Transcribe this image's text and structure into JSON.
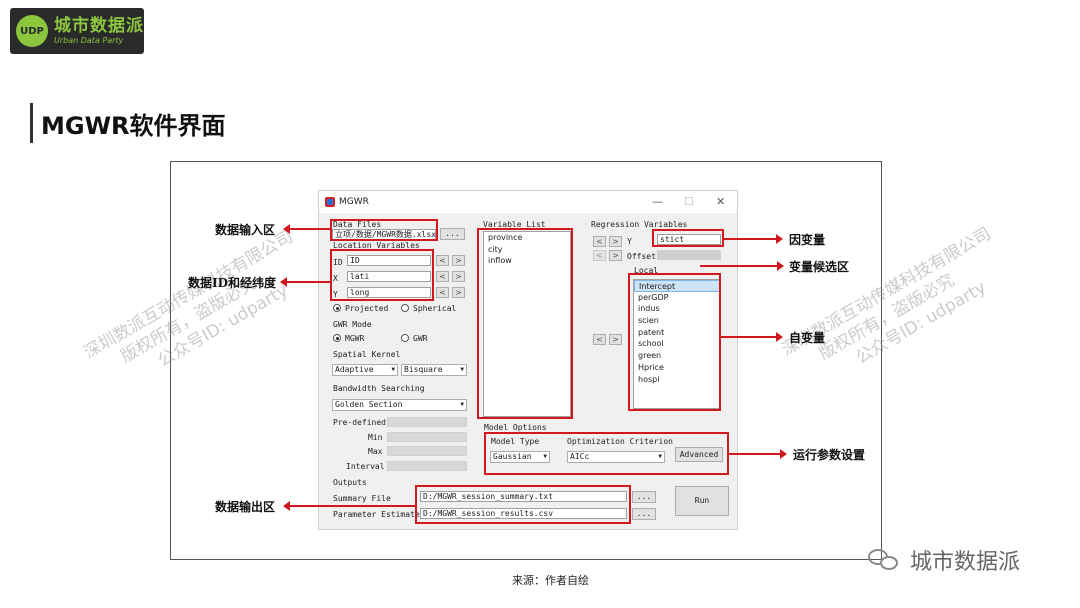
{
  "logo": {
    "badge": "UDP",
    "cn": "城市数据派",
    "en": "Urban Data Party"
  },
  "page_title": "MGWR软件界面",
  "caption": "来源：作者自绘",
  "wechat_brand": "城市数据派",
  "watermark": {
    "line1": "深圳数派互动传媒科技有限公司",
    "line2": "版权所有，盗版必究",
    "line3": "公众号ID: udparty"
  },
  "annotations": {
    "data_input": "数据输入区",
    "id_coords": "数据ID和经纬度",
    "data_output": "数据输出区",
    "dependent_var": "因变量",
    "candidate_vars": "变量候选区",
    "independent_vars": "自变量",
    "run_params": "运行参数设置"
  },
  "window": {
    "title": "MGWR",
    "controls": {
      "minimize": "—",
      "maximize": "☐",
      "close": "✕"
    },
    "data_files": {
      "label": "Data Files",
      "path": "立项/数据/MGWR数据.xlsx",
      "browse": "..."
    },
    "location_variables": {
      "label": "Location Variables",
      "id_label": "ID",
      "id_value": "ID",
      "x_label": "X",
      "x_value": "lati",
      "y_label": "Y",
      "y_value": "long",
      "projected": "Projected",
      "spherical": "Spherical"
    },
    "gwr_mode": {
      "label": "GWR Mode",
      "mgwr": "MGWR",
      "gwr": "GWR"
    },
    "spatial_kernel": {
      "label": "Spatial Kernel",
      "kernel_type": "Adaptive",
      "kernel_shape": "Bisquare"
    },
    "bandwidth": {
      "label": "Bandwidth Searching",
      "method": "Golden Section",
      "predefined": "Pre-defined",
      "min": "Min",
      "max": "Max",
      "interval": "Interval"
    },
    "variable_list": {
      "label": "Variable List",
      "items": [
        "province",
        "city",
        "inflow"
      ]
    },
    "regression_variables": {
      "label": "Regression Variables",
      "y_label": "Y",
      "y_value": "stict",
      "offset_label": "Offset",
      "local_label": "Local",
      "local_items": [
        "Intercept",
        "perGDP",
        "indus",
        "scien",
        "patent",
        "school",
        "green",
        "Hprice",
        "hospi"
      ]
    },
    "model_options": {
      "label": "Model Options",
      "model_type_label": "Model Type",
      "model_type": "Gaussian",
      "criterion_label": "Optimization Criterion",
      "criterion": "AICc",
      "advanced": "Advanced"
    },
    "outputs": {
      "label": "Outputs",
      "summary_label": "Summary File",
      "summary_path": "D:/MGWR_session_summary.txt",
      "params_label": "Parameter Estimates",
      "params_path": "D:/MGWR_session_results.csv",
      "browse": "...",
      "run": "Run"
    },
    "arrows": {
      "left": "<",
      "right": ">"
    }
  }
}
